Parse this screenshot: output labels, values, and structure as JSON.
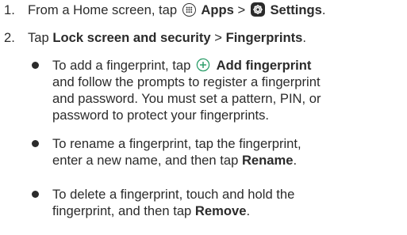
{
  "steps": [
    {
      "number": "1.",
      "lead": "From a Home screen, tap",
      "apps_label": "Apps",
      "separator": ">",
      "settings_label": "Settings",
      "end": "."
    },
    {
      "number": "2.",
      "lead": "Tap",
      "lock_label": "Lock screen and security",
      "separator": ">",
      "fingerprints_label": "Fingerprints",
      "end": "."
    }
  ],
  "bullets": [
    {
      "line1_pre": "To add a fingerprint, tap",
      "line1_bold": "Add fingerprint",
      "line2": "and follow the prompts to register a fingerprint",
      "line3": "and password. You must set a pattern, PIN, or",
      "line4": "password to protect your fingerprints."
    },
    {
      "line1": "To rename a fingerprint, tap the fingerprint,",
      "line2_pre": "enter a new name, and then tap",
      "line2_bold": "Rename",
      "line2_end": "."
    },
    {
      "line1": "To delete a fingerprint, touch and hold the",
      "line2_pre": "fingerprint, and then tap",
      "line2_bold": "Remove",
      "line2_end": "."
    }
  ],
  "icons": {
    "apps": "apps-icon",
    "settings": "settings-icon",
    "add": "add-circle-icon"
  },
  "colors": {
    "text": "#2b2b2b",
    "add_icon": "#2e9e6b"
  }
}
